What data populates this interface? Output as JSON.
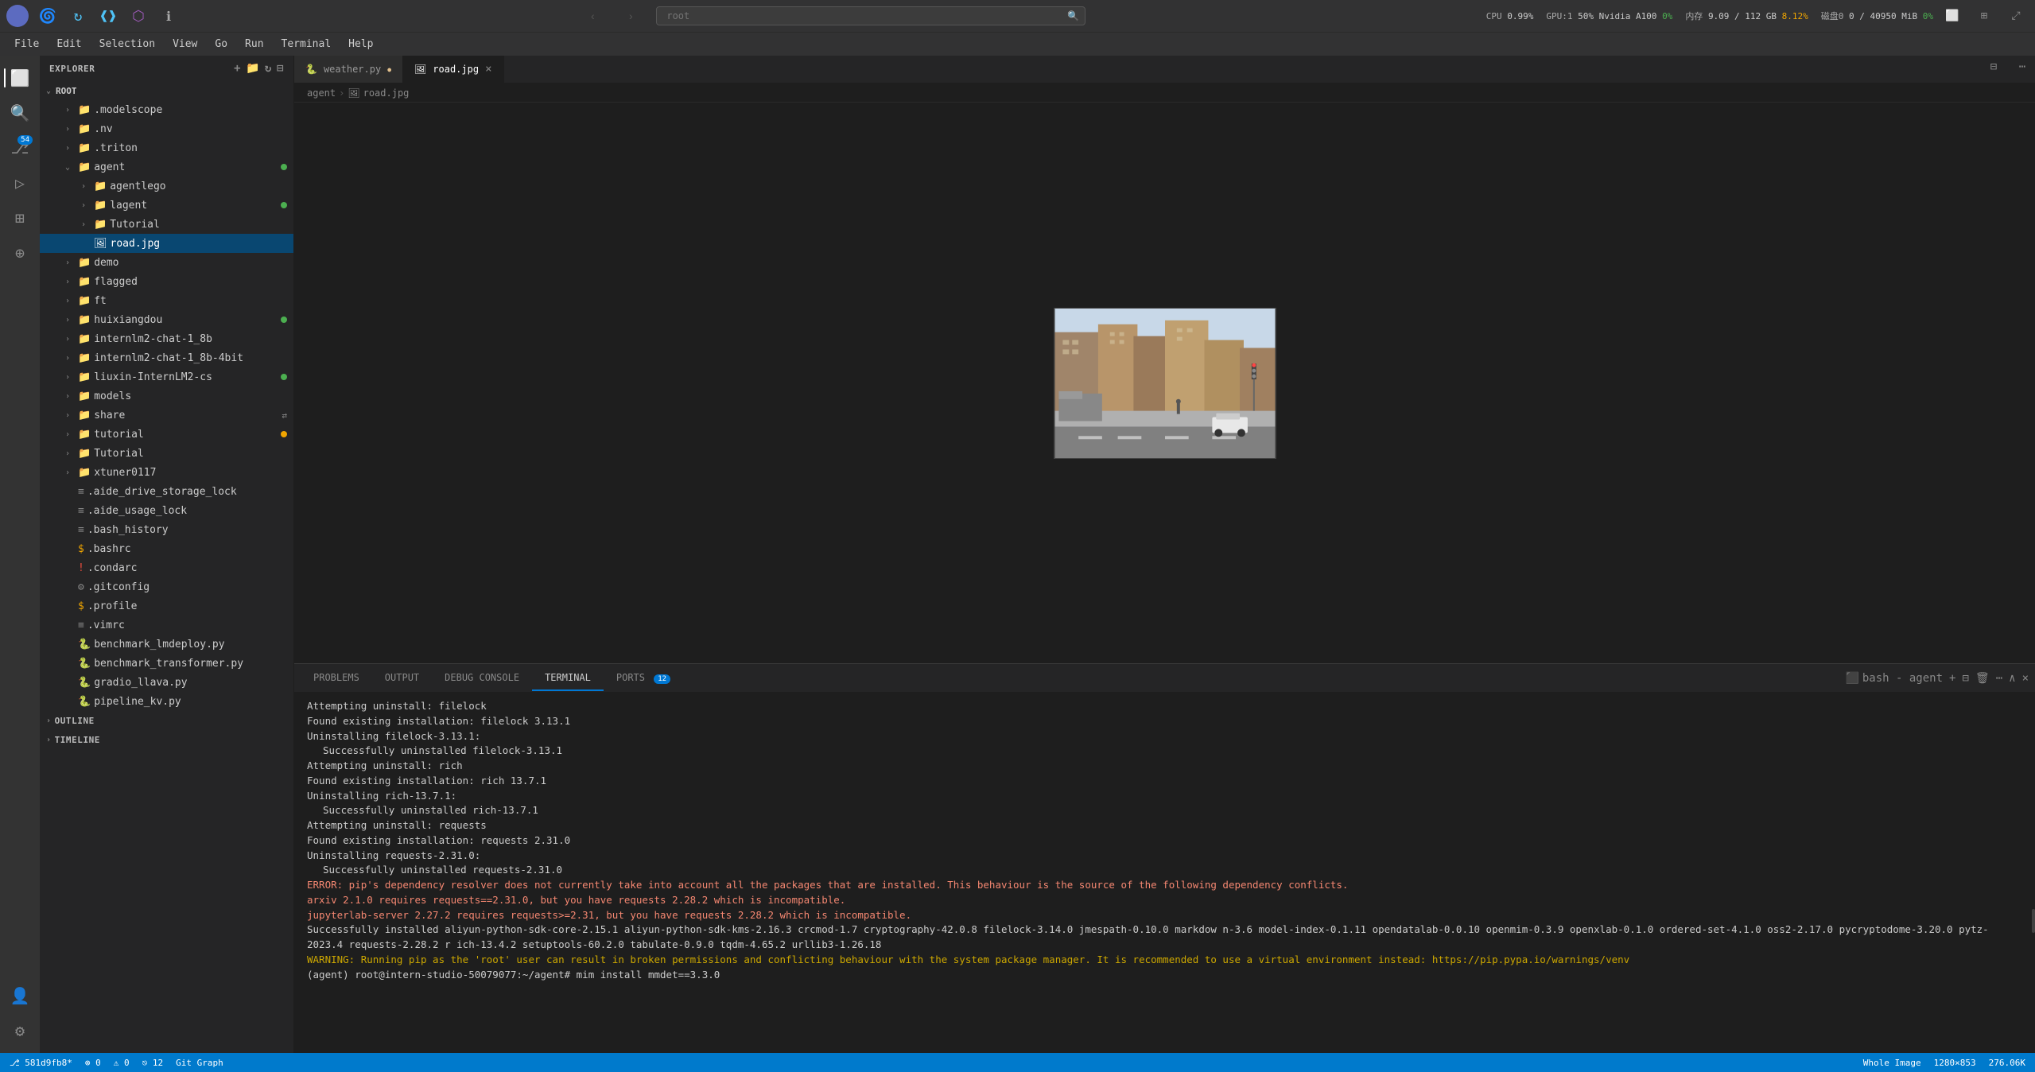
{
  "topbar": {
    "icons": [
      "🌀",
      "🔄",
      "💙",
      "◇",
      "⊙"
    ],
    "system": {
      "cpu_label": "CPU",
      "cpu_value": "0.99%",
      "gpu_label": "GPU:1",
      "gpu_value": "50% Nvidia A100",
      "gpu_pct": "0%",
      "mem_label": "内存",
      "mem_value": "9.09 / 112 GB",
      "mem_pct": "8.12%",
      "disk_label": "磁盘0",
      "disk_value": "0 / 40950 MiB",
      "disk_pct": "0%"
    }
  },
  "menubar": {
    "items": [
      "File",
      "Edit",
      "Selection",
      "View",
      "Go",
      "Run",
      "Terminal",
      "Help"
    ]
  },
  "tabs": [
    {
      "id": "weather",
      "label": "weather.py",
      "modified": true,
      "icon": "🐍",
      "active": false
    },
    {
      "id": "road",
      "label": "road.jpg",
      "modified": false,
      "icon": "🖼",
      "active": true
    }
  ],
  "breadcrumb": {
    "parts": [
      "agent",
      "road.jpg"
    ]
  },
  "sidebar": {
    "title": "EXPLORER",
    "root_label": "ROOT",
    "items": [
      {
        "label": ".modelscope",
        "type": "folder",
        "indent": 1,
        "chevron": "›"
      },
      {
        "label": ".nv",
        "type": "folder",
        "indent": 1,
        "chevron": "›"
      },
      {
        "label": ".triton",
        "type": "folder",
        "indent": 1,
        "chevron": "›"
      },
      {
        "label": "agent",
        "type": "folder",
        "indent": 1,
        "chevron": "⌄",
        "dot": "green"
      },
      {
        "label": "agentlego",
        "type": "folder",
        "indent": 2,
        "chevron": "›"
      },
      {
        "label": "lagent",
        "type": "folder",
        "indent": 2,
        "chevron": "›",
        "dot": "green"
      },
      {
        "label": "Tutorial",
        "type": "folder",
        "indent": 2,
        "chevron": "›"
      },
      {
        "label": "road.jpg",
        "type": "file",
        "indent": 2,
        "selected": true,
        "icon": "🖼"
      },
      {
        "label": "demo",
        "type": "folder",
        "indent": 1,
        "chevron": "›"
      },
      {
        "label": "flagged",
        "type": "folder",
        "indent": 1,
        "chevron": "›"
      },
      {
        "label": "ft",
        "type": "folder",
        "indent": 1,
        "chevron": "›"
      },
      {
        "label": "huixiangdou",
        "type": "folder",
        "indent": 1,
        "chevron": "›",
        "dot": "green"
      },
      {
        "label": "internlm2-chat-1_8b",
        "type": "folder",
        "indent": 1,
        "chevron": "›"
      },
      {
        "label": "internlm2-chat-1_8b-4bit",
        "type": "folder",
        "indent": 1,
        "chevron": "›"
      },
      {
        "label": "liuxin-InternLM2-cs",
        "type": "folder",
        "indent": 1,
        "chevron": "›",
        "dot": "green"
      },
      {
        "label": "models",
        "type": "folder",
        "indent": 1,
        "chevron": "›"
      },
      {
        "label": "share",
        "type": "folder",
        "indent": 1,
        "chevron": "›",
        "share": true
      },
      {
        "label": "tutorial",
        "type": "folder",
        "indent": 1,
        "chevron": "›",
        "dot": "yellow"
      },
      {
        "label": "Tutorial",
        "type": "folder",
        "indent": 1,
        "chevron": "›"
      },
      {
        "label": "xtuner0117",
        "type": "folder",
        "indent": 1,
        "chevron": "›"
      },
      {
        "label": ".aide_drive_storage_lock",
        "type": "file",
        "indent": 1,
        "icon": "≡"
      },
      {
        "label": ".aide_usage_lock",
        "type": "file",
        "indent": 1,
        "icon": "≡"
      },
      {
        "label": ".bash_history",
        "type": "file",
        "indent": 1,
        "icon": "≡"
      },
      {
        "label": ".bashrc",
        "type": "file",
        "indent": 1,
        "icon": "$"
      },
      {
        "label": ".condarc",
        "type": "file",
        "indent": 1,
        "icon": "!"
      },
      {
        "label": ".gitconfig",
        "type": "file",
        "indent": 1,
        "icon": "⚙"
      },
      {
        "label": ".profile",
        "type": "file",
        "indent": 1,
        "icon": "$"
      },
      {
        "label": ".vimrc",
        "type": "file",
        "indent": 1,
        "icon": "≡"
      },
      {
        "label": "benchmark_lmdeploy.py",
        "type": "file",
        "indent": 1,
        "icon": "🐍"
      },
      {
        "label": "benchmark_transformer.py",
        "type": "file",
        "indent": 1,
        "icon": "🐍"
      },
      {
        "label": "gradio_llava.py",
        "type": "file",
        "indent": 1,
        "icon": "🐍"
      },
      {
        "label": "pipeline_kv.py",
        "type": "file",
        "indent": 1,
        "icon": "🐍"
      }
    ],
    "sections": [
      {
        "label": "OUTLINE"
      },
      {
        "label": "TIMELINE"
      }
    ]
  },
  "terminal": {
    "tabs": [
      {
        "label": "PROBLEMS",
        "active": false
      },
      {
        "label": "OUTPUT",
        "active": false
      },
      {
        "label": "DEBUG CONSOLE",
        "active": false
      },
      {
        "label": "TERMINAL",
        "active": true
      },
      {
        "label": "PORTS",
        "active": false,
        "badge": "12"
      }
    ],
    "instance_label": "bash - agent",
    "lines": [
      {
        "text": "    Attempting uninstall: filelock",
        "type": "normal"
      },
      {
        "text": "      Found existing installation: filelock 3.13.1",
        "type": "normal"
      },
      {
        "text": "      Uninstalling filelock-3.13.1:",
        "type": "normal"
      },
      {
        "text": "        Successfully uninstalled filelock-3.13.1",
        "type": "normal"
      },
      {
        "text": "    Attempting uninstall: rich",
        "type": "normal"
      },
      {
        "text": "      Found existing installation: rich 13.7.1",
        "type": "normal"
      },
      {
        "text": "      Uninstalling rich-13.7.1:",
        "type": "normal"
      },
      {
        "text": "        Successfully uninstalled rich-13.7.1",
        "type": "normal"
      },
      {
        "text": "    Attempting uninstall: requests",
        "type": "normal"
      },
      {
        "text": "      Found existing installation: requests 2.31.0",
        "type": "normal"
      },
      {
        "text": "      Uninstalling requests-2.31.0:",
        "type": "normal"
      },
      {
        "text": "        Successfully uninstalled requests-2.31.0",
        "type": "normal"
      },
      {
        "text": "ERROR: pip's dependency resolver does not currently take into account all the packages that are installed. This behaviour is the source of the following dependency conflicts.",
        "type": "error"
      },
      {
        "text": "  arxiv 2.1.0 requires requests==2.31.0, but you have requests 2.28.2 which is incompatible.",
        "type": "error"
      },
      {
        "text": "  jupyterlab-server 2.27.2 requires requests>=2.31, but you have requests 2.28.2 which is incompatible.",
        "type": "error"
      },
      {
        "text": "Successfully installed aliyun-python-sdk-core-2.15.1 aliyun-python-sdk-kms-2.16.3 crcmod-1.7 cryptography-42.0.8 filelock-3.14.0 jmespath-0.10.0 markdow n-3.6 model-index-0.1.11 opendatalab-0.0.10 openmim-0.3.9 openxlab-0.1.0 ordered-set-4.1.0 oss2-2.17.0 pycryptodome-3.20.0 pytz-2023.4 requests-2.28.2 r ich-13.4.2 setuptools-60.2.0 tabulate-0.9.0 tqdm-4.65.2 urllib3-1.26.18",
        "type": "normal"
      },
      {
        "text": "WARNING: Running pip as the 'root' user can result in broken permissions and conflicting behaviour with the system package manager. It is recommended to use a virtual environment instead: https://pip.pypa.io/warnings/venv",
        "type": "warning"
      },
      {
        "text": "(agent) root@intern-studio-50079077:~/agent# mim install mmdet==3.3.0",
        "type": "prompt"
      }
    ]
  },
  "statusbar": {
    "git": "⎇ 581d9fb8*",
    "errors": "⊗ 0",
    "warnings": "⚠ 0",
    "branch_count": "⎋ 12",
    "git_graph": "Git Graph",
    "right": {
      "zoom": "Whole Image",
      "resolution": "1280×853",
      "size": "276.06K"
    }
  },
  "search": {
    "placeholder": "root",
    "value": ""
  }
}
